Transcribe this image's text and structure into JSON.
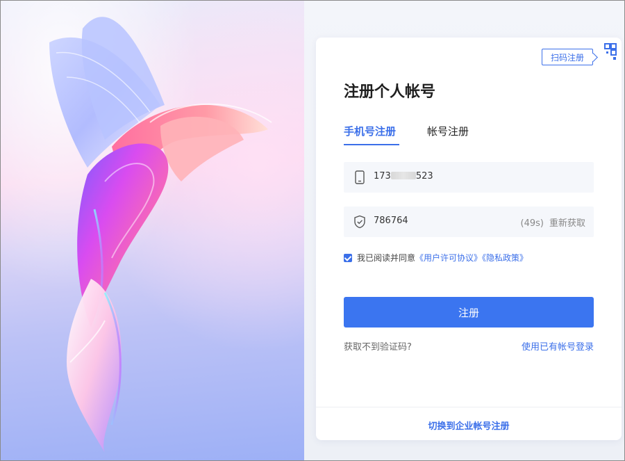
{
  "hero": {
    "illustration": "abstract-ribbon-bird"
  },
  "card": {
    "qr_tip": "扫码注册",
    "qr_icon": "qr-code-icon",
    "title": "注册个人帐号",
    "tabs": [
      {
        "label": "手机号注册",
        "active": true
      },
      {
        "label": "帐号注册",
        "active": false
      }
    ],
    "phone": {
      "icon": "phone-icon",
      "prefix": "173",
      "suffix": "523"
    },
    "code": {
      "icon": "shield-icon",
      "value": "786764",
      "countdown": "(49s)",
      "resend": "重新获取"
    },
    "agreement": {
      "checked": true,
      "text": "我已阅读并同意",
      "user_agreement": "《用户许可协议》",
      "privacy_policy": "《隐私政策》"
    },
    "submit": "注册",
    "help_link": "获取不到验证码?",
    "login_link": "使用已有帐号登录",
    "enterprise_link": "切换到企业帐号注册"
  },
  "colors": {
    "accent": "#3b6fe9",
    "button": "#3b75f0",
    "field_bg": "#f5f7fb"
  }
}
